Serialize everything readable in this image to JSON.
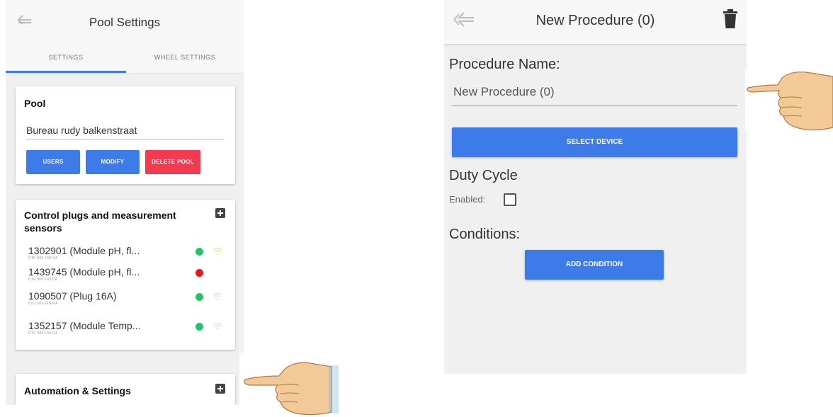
{
  "left_screen": {
    "title": "Pool Settings",
    "tabs": [
      {
        "label": "SETTINGS",
        "active": true
      },
      {
        "label": "WHEEL SETTINGS",
        "active": false
      }
    ],
    "pool_card": {
      "title": "Pool",
      "pool_name": "Bureau rudy balkenstraat",
      "buttons": {
        "users": "USERS",
        "modify": "MODIFY",
        "delete": "DELETE POOL"
      }
    },
    "devices_card": {
      "title_line1": "Control plugs and measurement",
      "title_line2": "sensors",
      "devices": [
        {
          "name": "1302901 (Module pH, fl...",
          "sub": "DTF 000 FIN CA",
          "status": "online"
        },
        {
          "name": "1439745 (Module pH, fl...",
          "sub": "DTF 000 FIN CA",
          "status": "offline"
        },
        {
          "name": "1090507 (Plug 16A)",
          "sub": "DSZ 000 FIN RA",
          "status": "online"
        },
        {
          "name": "1352157 (Module Temp...",
          "sub": "DTF 000 FIN CA",
          "status": "online"
        }
      ]
    },
    "automation_card": {
      "title": "Automation & Settings"
    }
  },
  "right_screen": {
    "title": "New Procedure (0)",
    "procedure_name_label": "Procedure Name:",
    "procedure_name_value": "New Procedure (0)",
    "select_device_button": "SELECT DEVICE",
    "duty_cycle_label": "Duty Cycle",
    "enabled_label": "Enabled:",
    "enabled_checked": false,
    "conditions_label": "Conditions:",
    "add_condition_button": "ADD CONDITION"
  },
  "colors": {
    "primary_blue": "#3d7ce8",
    "delete_red": "#f23a50",
    "status_online": "#25c466",
    "status_offline": "#e8141a"
  },
  "icons": [
    "back-arrow-icon",
    "trash-icon",
    "plus-icon",
    "wifi-icon",
    "pointing-hand-icon"
  ]
}
